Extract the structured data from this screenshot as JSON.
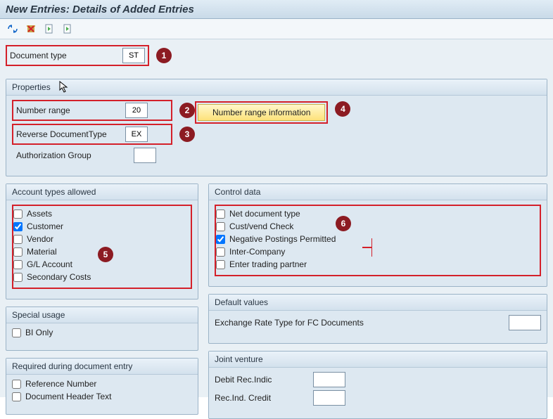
{
  "title": "New Entries: Details of Added Entries",
  "doc_type": {
    "label": "Document type",
    "value": "ST"
  },
  "properties": {
    "title": "Properties",
    "number_range": {
      "label": "Number range",
      "value": "20"
    },
    "reverse_doc": {
      "label": "Reverse DocumentType",
      "value": "EX"
    },
    "auth_group": {
      "label": "Authorization Group",
      "value": ""
    },
    "btn": "Number range information"
  },
  "account_types": {
    "title": "Account types allowed",
    "items": [
      {
        "label": "Assets",
        "checked": false
      },
      {
        "label": "Customer",
        "checked": true
      },
      {
        "label": "Vendor",
        "checked": false
      },
      {
        "label": "Material",
        "checked": false
      },
      {
        "label": "G/L Account",
        "checked": false
      },
      {
        "label": "Secondary Costs",
        "checked": false
      }
    ]
  },
  "control_data": {
    "title": "Control data",
    "items": [
      {
        "label": "Net document type",
        "checked": false
      },
      {
        "label": "Cust/vend Check",
        "checked": false
      },
      {
        "label": "Negative Postings Permitted",
        "checked": true
      },
      {
        "label": "Inter-Company",
        "checked": false
      },
      {
        "label": "Enter trading partner",
        "checked": false
      }
    ]
  },
  "special_usage": {
    "title": "Special usage",
    "bi_only": "BI Only"
  },
  "default_values": {
    "title": "Default values",
    "exch": "Exchange Rate Type for FC Documents"
  },
  "required_entry": {
    "title": "Required during document entry",
    "ref_no": "Reference Number",
    "doc_header": "Document Header Text"
  },
  "joint_venture": {
    "title": "Joint venture",
    "debit": "Debit Rec.Indic",
    "credit": "Rec.Ind. Credit"
  },
  "callouts": {
    "c1": "1",
    "c2": "2",
    "c3": "3",
    "c4": "4",
    "c5": "5",
    "c6": "6"
  }
}
